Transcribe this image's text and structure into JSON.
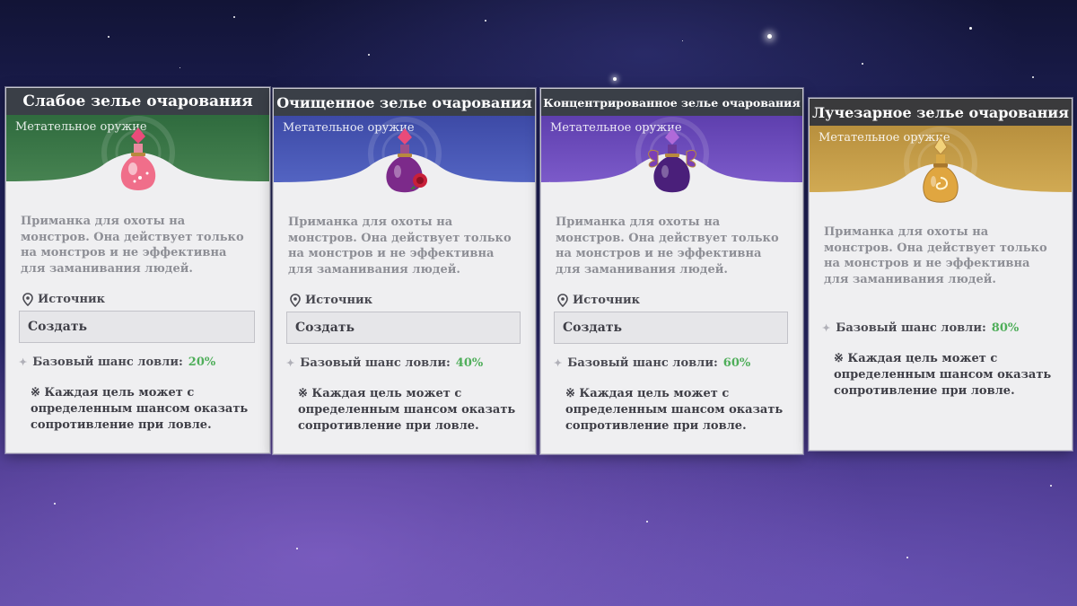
{
  "colors": {
    "title_bar": "#3a3f47",
    "card_body": "#efeff1",
    "chance_value": "#4fae5a",
    "desc_text": "#8e8f96"
  },
  "cards": [
    {
      "title": "Слабое зелье очарования",
      "subtitle": "Метательное оружие",
      "header_color": "#4e8a57",
      "bottle_icon": "pink-potion-icon",
      "description": "Приманка для охоты на монстров. Она действует только на монстров и не эффективна для заманивания людей.",
      "source_label": "Источник",
      "source_value": "Создать",
      "chance_label": "Базовый шанс ловли:",
      "chance_value": "20%",
      "note": "※ Каждая цель может с определенным шансом оказать сопротивление при ловле."
    },
    {
      "title": "Очищенное зелье очарования",
      "subtitle": "Метательное оружие",
      "header_color": "#5565c2",
      "bottle_icon": "rose-potion-icon",
      "description": "Приманка для охоты на монстров. Она действует только на монстров и не эффективна для заманивания людей.",
      "source_label": "Источник",
      "source_value": "Создать",
      "chance_label": "Базовый шанс ловли:",
      "chance_value": "40%",
      "note": "※ Каждая цель может с определенным шансом оказать сопротивление при ловле."
    },
    {
      "title": "Концентрированное зелье очарования",
      "subtitle": "Метательное оружие",
      "header_color": "#7a55c9",
      "bottle_icon": "butterfly-potion-icon",
      "description": "Приманка для охоты на монстров. Она действует только на монстров и не эффективна для заманивания людей.",
      "source_label": "Источник",
      "source_value": "Создать",
      "chance_label": "Базовый шанс ловли:",
      "chance_value": "60%",
      "note": "※ Каждая цель может с определенным шансом оказать сопротивление при ловле."
    },
    {
      "title": "Лучезарное зелье очарования",
      "subtitle": "Метательное оружие",
      "header_color": "#c9a24e",
      "bottle_icon": "golden-potion-icon",
      "description": "Приманка для охоты на монстров. Она действует только на монстров и не эффективна для заманивания людей.",
      "chance_label": "Базовый шанс ловли:",
      "chance_value": "80%",
      "note": "※ Каждая цель может с определенным шансом оказать сопротивление при ловле."
    }
  ]
}
